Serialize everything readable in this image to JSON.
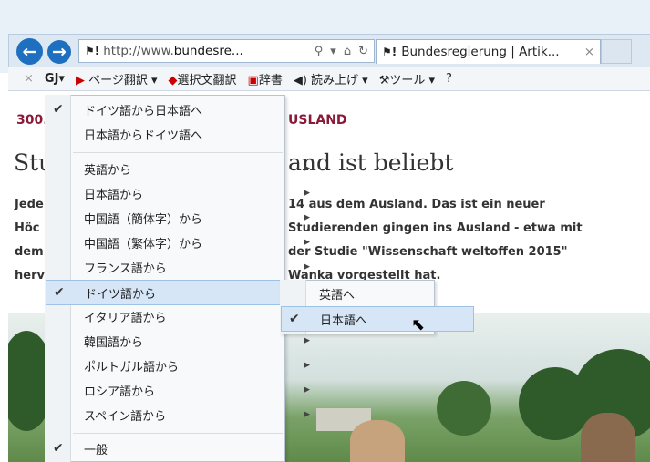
{
  "browser": {
    "address": {
      "scheme": "http://www.",
      "host": "bundesre...",
      "search_icon": "search-icon",
      "chevron": "▾",
      "lock_icon": "lock-icon",
      "refresh_icon": "refresh-icon"
    },
    "tab": {
      "title": "Bundesregierung | Artik...",
      "close": "×"
    }
  },
  "toolbar": {
    "close": "×",
    "logo": "GJ▾",
    "page_translate": "ページ翻訳 ▾",
    "selection_translate": "選択文翻訳",
    "dictionary": "辞書",
    "read_aloud": "読み上げ ▾",
    "tools": "ツール ▾"
  },
  "article": {
    "kicker_left": "300.",
    "kicker_right": "USLAND",
    "headline_left": "Stu",
    "headline_right": "and ist beliebt",
    "lines_left": [
      "Jede",
      "Höc",
      "dem",
      "herv"
    ],
    "lines_right": [
      "14 aus dem Ausland. Das ist ein neuer",
      "Studierenden gingen ins Ausland - etwa mit",
      "der Studie \"Wissenschaft weltoffen 2015\"",
      "Wanka vorgestellt hat."
    ]
  },
  "menu": {
    "items": [
      {
        "label": "ドイツ語から日本語へ",
        "checked": true,
        "submenu": false
      },
      {
        "label": "日本語からドイツ語へ",
        "checked": false,
        "submenu": false
      },
      {
        "label": "英語から",
        "checked": false,
        "submenu": true
      },
      {
        "label": "日本語から",
        "checked": false,
        "submenu": true
      },
      {
        "label": "中国語（簡体字）から",
        "checked": false,
        "submenu": true
      },
      {
        "label": "中国語（繁体字）から",
        "checked": false,
        "submenu": true
      },
      {
        "label": "フランス語から",
        "checked": false,
        "submenu": true
      },
      {
        "label": "ドイツ語から",
        "checked": true,
        "submenu": true
      },
      {
        "label": "イタリア語から",
        "checked": false,
        "submenu": true
      },
      {
        "label": "韓国語から",
        "checked": false,
        "submenu": true
      },
      {
        "label": "ポルトガル語から",
        "checked": false,
        "submenu": true
      },
      {
        "label": "ロシア語から",
        "checked": false,
        "submenu": true
      },
      {
        "label": "スペイン語から",
        "checked": false,
        "submenu": true
      },
      {
        "label": "一般",
        "checked": true,
        "submenu": false
      }
    ],
    "submenu": [
      {
        "label": "英語へ",
        "checked": false
      },
      {
        "label": "日本語へ",
        "checked": true
      }
    ]
  }
}
